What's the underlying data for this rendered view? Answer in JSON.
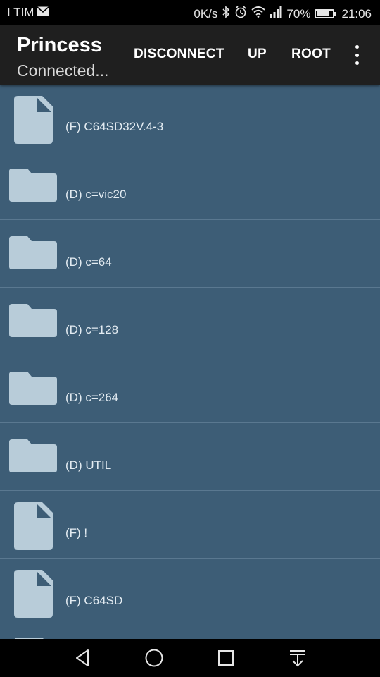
{
  "status_bar": {
    "carrier": "I TIM",
    "speed": "0K/s",
    "battery": "70%",
    "battery_level": 0.7,
    "time": "21:06"
  },
  "app_bar": {
    "title": "Princess",
    "subtitle": "Connected...",
    "actions": [
      "DISCONNECT",
      "UP",
      "ROOT"
    ]
  },
  "items": [
    {
      "type": "file",
      "label": "(F) C64SD32V.4-3"
    },
    {
      "type": "folder",
      "label": "(D) c=vic20"
    },
    {
      "type": "folder",
      "label": "(D) c=64"
    },
    {
      "type": "folder",
      "label": "(D) c=128"
    },
    {
      "type": "folder",
      "label": "(D) c=264"
    },
    {
      "type": "folder",
      "label": "(D) UTIL"
    },
    {
      "type": "file",
      "label": "(F) !"
    },
    {
      "type": "file",
      "label": "(F) C64SD"
    },
    {
      "type": "file",
      "label": ""
    }
  ],
  "colors": {
    "list_bg": "#3d5d76",
    "icon": "#b8ccd9",
    "appbar_bg": "#1f1f1f"
  }
}
